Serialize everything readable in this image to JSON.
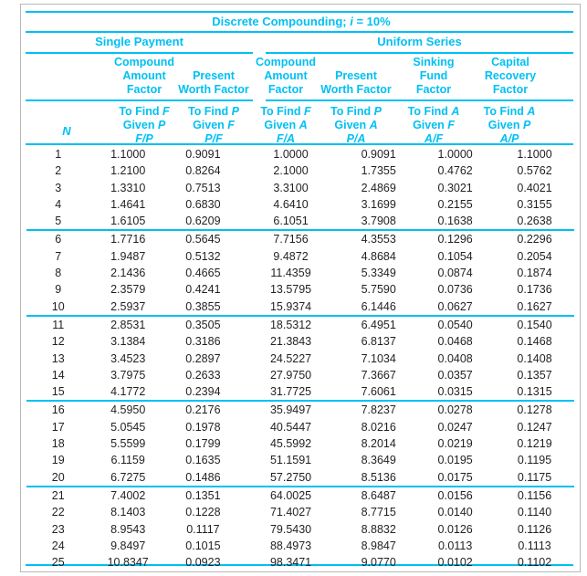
{
  "title": {
    "text_prefix": "Discrete Compounding; ",
    "italic_var": "i",
    "text_suffix": " = 10%",
    "full": "Discrete Compounding; i = 10%"
  },
  "groups": {
    "single_payment": "Single Payment",
    "uniform_series": "Uniform Series"
  },
  "factor_names": {
    "fp": [
      "Compound",
      "Amount",
      "Factor"
    ],
    "pf": [
      "",
      "Present",
      "Worth Factor"
    ],
    "fa": [
      "Compound",
      "Amount",
      "Factor"
    ],
    "pa": [
      "",
      "Present",
      "Worth Factor"
    ],
    "af": [
      "Sinking",
      "Fund",
      "Factor"
    ],
    "ap": [
      "Capital",
      "Recovery",
      "Factor"
    ]
  },
  "find_given": {
    "fp": {
      "find": "To Find ",
      "find_var": "F",
      "given": "Given ",
      "given_var": "P",
      "ratio_num": "F",
      "ratio_den": "P"
    },
    "pf": {
      "find": "To Find ",
      "find_var": "P",
      "given": "Given ",
      "given_var": "F",
      "ratio_num": "P",
      "ratio_den": "F"
    },
    "fa": {
      "find": "To Find ",
      "find_var": "F",
      "given": "Given ",
      "given_var": "A",
      "ratio_num": "F",
      "ratio_den": "A"
    },
    "pa": {
      "find": "To Find ",
      "find_var": "P",
      "given": "Given ",
      "given_var": "A",
      "ratio_num": "P",
      "ratio_den": "A"
    },
    "af": {
      "find": "To Find ",
      "find_var": "A",
      "given": "Given ",
      "given_var": "F",
      "ratio_num": "A",
      "ratio_den": "F"
    },
    "ap": {
      "find": "To Find ",
      "find_var": "A",
      "given": "Given ",
      "given_var": "P",
      "ratio_num": "A",
      "ratio_den": "P"
    }
  },
  "n_column_header": "N",
  "colors": {
    "accent": "#00c0f3",
    "text": "#231f20",
    "border": "#b9b9b9",
    "background": "#ffffff"
  },
  "chart_data": {
    "type": "table",
    "title": "Discrete Compounding; i = 10%",
    "interest_rate": "10%",
    "columns": [
      "N",
      "F/P",
      "P/F",
      "F/A",
      "P/A",
      "A/F",
      "A/P"
    ],
    "column_groups": [
      {
        "name": "Single Payment",
        "columns": [
          "F/P",
          "P/F"
        ]
      },
      {
        "name": "Uniform Series",
        "columns": [
          "F/A",
          "P/A",
          "A/F",
          "A/P"
        ]
      }
    ],
    "rows": [
      [
        "1",
        "1.1000",
        "0.9091",
        "1.0000",
        "0.9091",
        "1.0000",
        "1.1000"
      ],
      [
        "2",
        "1.2100",
        "0.8264",
        "2.1000",
        "1.7355",
        "0.4762",
        "0.5762"
      ],
      [
        "3",
        "1.3310",
        "0.7513",
        "3.3100",
        "2.4869",
        "0.3021",
        "0.4021"
      ],
      [
        "4",
        "1.4641",
        "0.6830",
        "4.6410",
        "3.1699",
        "0.2155",
        "0.3155"
      ],
      [
        "5",
        "1.6105",
        "0.6209",
        "6.1051",
        "3.7908",
        "0.1638",
        "0.2638"
      ],
      [
        "6",
        "1.7716",
        "0.5645",
        "7.7156",
        "4.3553",
        "0.1296",
        "0.2296"
      ],
      [
        "7",
        "1.9487",
        "0.5132",
        "9.4872",
        "4.8684",
        "0.1054",
        "0.2054"
      ],
      [
        "8",
        "2.1436",
        "0.4665",
        "11.4359",
        "5.3349",
        "0.0874",
        "0.1874"
      ],
      [
        "9",
        "2.3579",
        "0.4241",
        "13.5795",
        "5.7590",
        "0.0736",
        "0.1736"
      ],
      [
        "10",
        "2.5937",
        "0.3855",
        "15.9374",
        "6.1446",
        "0.0627",
        "0.1627"
      ],
      [
        "11",
        "2.8531",
        "0.3505",
        "18.5312",
        "6.4951",
        "0.0540",
        "0.1540"
      ],
      [
        "12",
        "3.1384",
        "0.3186",
        "21.3843",
        "6.8137",
        "0.0468",
        "0.1468"
      ],
      [
        "13",
        "3.4523",
        "0.2897",
        "24.5227",
        "7.1034",
        "0.0408",
        "0.1408"
      ],
      [
        "14",
        "3.7975",
        "0.2633",
        "27.9750",
        "7.3667",
        "0.0357",
        "0.1357"
      ],
      [
        "15",
        "4.1772",
        "0.2394",
        "31.7725",
        "7.6061",
        "0.0315",
        "0.1315"
      ],
      [
        "16",
        "4.5950",
        "0.2176",
        "35.9497",
        "7.8237",
        "0.0278",
        "0.1278"
      ],
      [
        "17",
        "5.0545",
        "0.1978",
        "40.5447",
        "8.0216",
        "0.0247",
        "0.1247"
      ],
      [
        "18",
        "5.5599",
        "0.1799",
        "45.5992",
        "8.2014",
        "0.0219",
        "0.1219"
      ],
      [
        "19",
        "6.1159",
        "0.1635",
        "51.1591",
        "8.3649",
        "0.0195",
        "0.1195"
      ],
      [
        "20",
        "6.7275",
        "0.1486",
        "57.2750",
        "8.5136",
        "0.0175",
        "0.1175"
      ],
      [
        "21",
        "7.4002",
        "0.1351",
        "64.0025",
        "8.6487",
        "0.0156",
        "0.1156"
      ],
      [
        "22",
        "8.1403",
        "0.1228",
        "71.4027",
        "8.7715",
        "0.0140",
        "0.1140"
      ],
      [
        "23",
        "8.9543",
        "0.1117",
        "79.5430",
        "8.8832",
        "0.0126",
        "0.1126"
      ],
      [
        "24",
        "9.8497",
        "0.1015",
        "88.4973",
        "8.9847",
        "0.0113",
        "0.1113"
      ],
      [
        "25",
        "10.8347",
        "0.0923",
        "98.3471",
        "9.0770",
        "0.0102",
        "0.1102"
      ]
    ],
    "band_size": 5
  }
}
